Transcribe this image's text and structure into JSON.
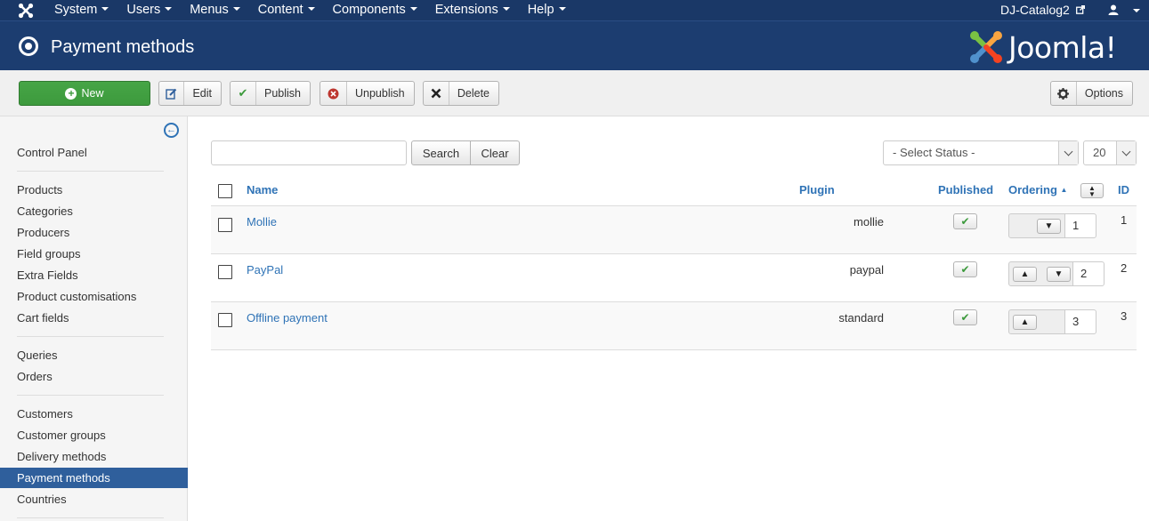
{
  "topnav": {
    "menu": [
      {
        "label": "System"
      },
      {
        "label": "Users"
      },
      {
        "label": "Menus"
      },
      {
        "label": "Content"
      },
      {
        "label": "Components"
      },
      {
        "label": "Extensions"
      },
      {
        "label": "Help"
      }
    ],
    "site_name": "DJ-Catalog2",
    "user_icon": "user-icon"
  },
  "header": {
    "title": "Payment methods",
    "brand_word": "Joomla!",
    "brand_icon": "joomla-logo-icon"
  },
  "toolbar": {
    "new_label": "New",
    "edit_label": "Edit",
    "publish_label": "Publish",
    "unpublish_label": "Unpublish",
    "delete_label": "Delete",
    "options_label": "Options"
  },
  "sidebar": {
    "items": [
      {
        "label": "Control Panel"
      },
      {
        "label": "Products"
      },
      {
        "label": "Categories"
      },
      {
        "label": "Producers"
      },
      {
        "label": "Field groups"
      },
      {
        "label": "Extra Fields"
      },
      {
        "label": "Product customisations"
      },
      {
        "label": "Cart fields"
      },
      {
        "label": "Queries"
      },
      {
        "label": "Orders"
      },
      {
        "label": "Customers"
      },
      {
        "label": "Customer groups"
      },
      {
        "label": "Delivery methods"
      },
      {
        "label": "Payment methods"
      },
      {
        "label": "Countries"
      }
    ],
    "active_index": 13
  },
  "filters": {
    "search_value": "",
    "search_label": "Search",
    "clear_label": "Clear",
    "status_selected": "- Select Status -",
    "limit_selected": "20"
  },
  "table": {
    "columns": {
      "name": "Name",
      "plugin": "Plugin",
      "published": "Published",
      "ordering": "Ordering",
      "id": "ID"
    },
    "rows": [
      {
        "name": "Mollie",
        "plugin": "mollie",
        "published": true,
        "order": "1",
        "id": "1"
      },
      {
        "name": "PayPal",
        "plugin": "paypal",
        "published": true,
        "order": "2",
        "id": "2"
      },
      {
        "name": "Offline payment",
        "plugin": "standard",
        "published": true,
        "order": "3",
        "id": "3"
      }
    ]
  },
  "colors": {
    "nav_bg": "#1a3867",
    "header_bg": "#1c3d70",
    "new_button": "#46a546",
    "link": "#2f73b6",
    "active_sidebar": "#2f5f9c"
  }
}
